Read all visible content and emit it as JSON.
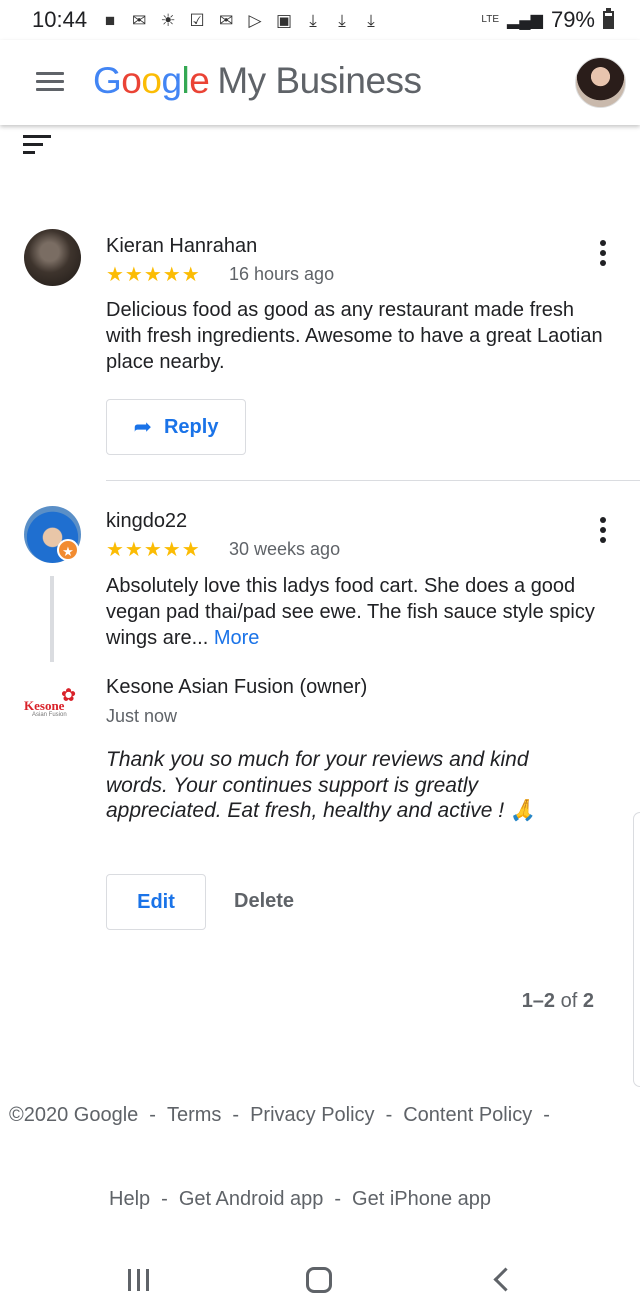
{
  "status_bar": {
    "time": "10:44",
    "network": "LTE",
    "battery": "79%",
    "battery_level": 0.79,
    "icons": [
      "bag-icon",
      "mail-icon",
      "weather-icon",
      "check-icon",
      "mail-icon",
      "play-icon",
      "image-icon",
      "download-icon",
      "download-icon",
      "download-icon"
    ]
  },
  "app_bar": {
    "logo_google": [
      "G",
      "o",
      "o",
      "g",
      "l",
      "e"
    ],
    "logo_suffix": "My Business"
  },
  "reviews": [
    {
      "name": "Kieran Hanrahan",
      "rating": 5,
      "stars": "★★★★★",
      "time": "16 hours ago",
      "text": "Delicious food as good as any restaurant made fresh with fresh ingredients. Awesome to have a great Laotian place nearby.",
      "reply_label": "Reply"
    },
    {
      "name": "kingdo22",
      "rating": 5,
      "stars": "★★★★★",
      "time": "30 weeks ago",
      "text": "Absolutely love this ladys food cart. She does a good vegan pad thai/pad see ewe. The fish sauce style spicy wings are...",
      "more_label": "More",
      "owner_reply": {
        "name": "Kesone Asian Fusion (owner)",
        "logo_text": "Kesone",
        "logo_subtext": "Asian Fusion",
        "time": "Just now",
        "text": "Thank you so much for your reviews and kind words. Your continues support is greatly appreciated. Eat fresh, healthy and active ! 🙏",
        "edit_label": "Edit",
        "delete_label": "Delete"
      }
    }
  ],
  "pagination": {
    "range": "1–2",
    "of_label": "of",
    "total": "2"
  },
  "footer": {
    "copyright": "©2020 Google",
    "terms": "Terms",
    "privacy": "Privacy Policy",
    "content_policy": "Content Policy",
    "help": "Help",
    "android_app": "Get Android app",
    "iphone_app": "Get iPhone app",
    "separator": "-"
  },
  "colors": {
    "link": "#1a73e8",
    "star": "#fbbc04",
    "muted": "#5f6368"
  }
}
